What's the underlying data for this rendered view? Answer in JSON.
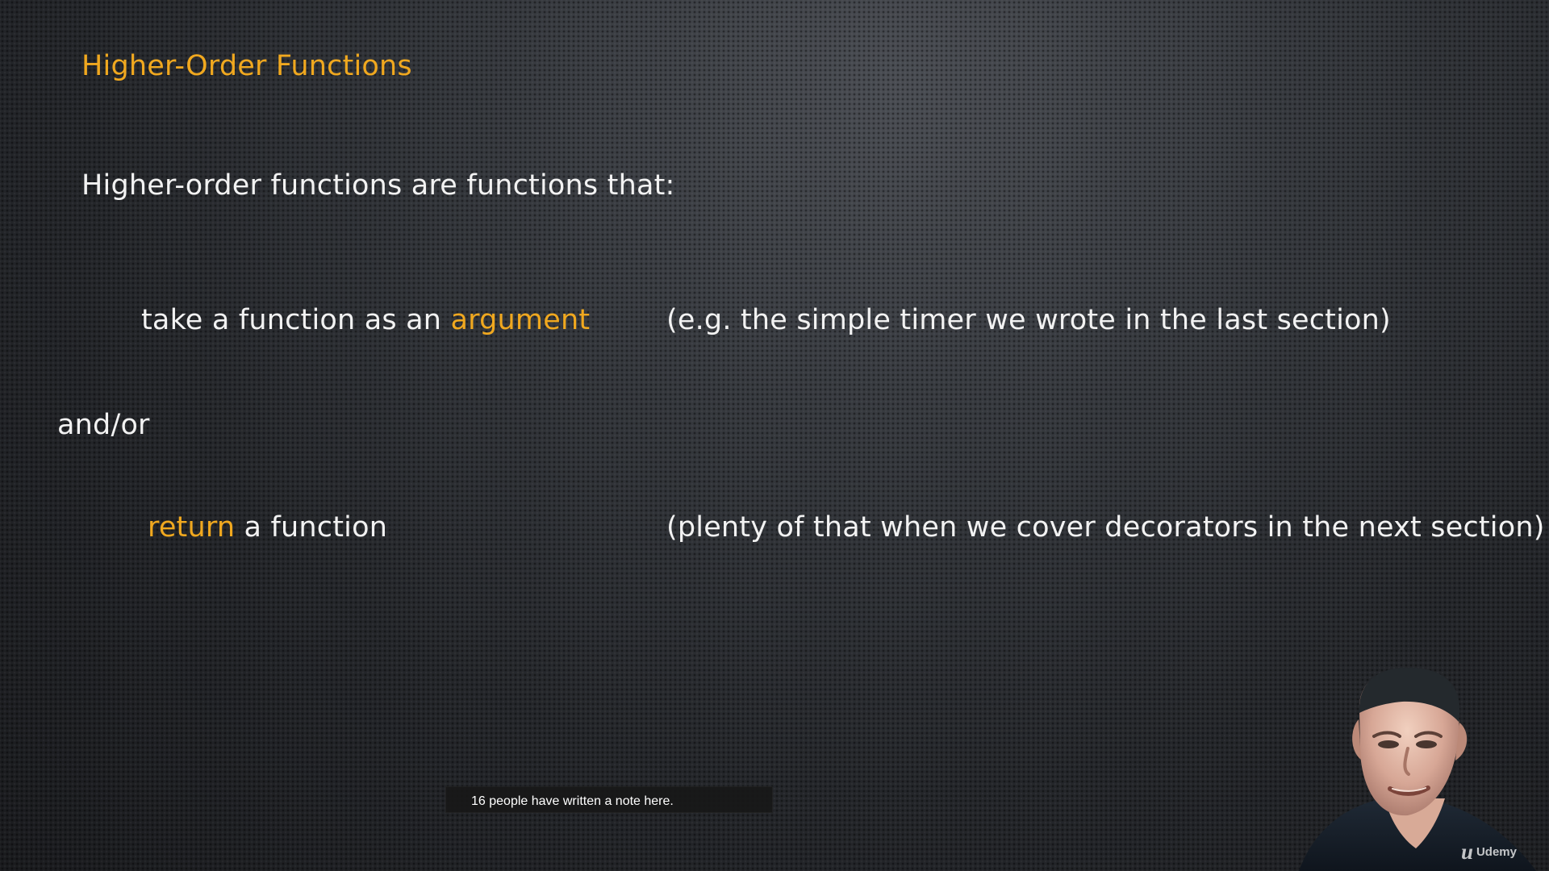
{
  "slide": {
    "title": "Higher-Order Functions",
    "lead": "Higher-order functions are functions that:",
    "bullet_1": {
      "prefix": "take a function as an ",
      "highlight": "argument",
      "note": "(e.g. the simple timer we wrote in the last section)"
    },
    "connector": "and/or",
    "bullet_2": {
      "highlight": "return",
      "suffix": " a function",
      "note": "(plenty of that when we cover decorators in the next section)"
    }
  },
  "note_tooltip": {
    "text": "16 people have written a note here."
  },
  "branding": {
    "logo_mark": "u",
    "logo_text": "Udemy"
  },
  "colors": {
    "accent": "#f0a81f",
    "text": "#f2f2f2"
  },
  "icons": {
    "presenter": "presenter-video",
    "logo": "udemy-logo"
  }
}
